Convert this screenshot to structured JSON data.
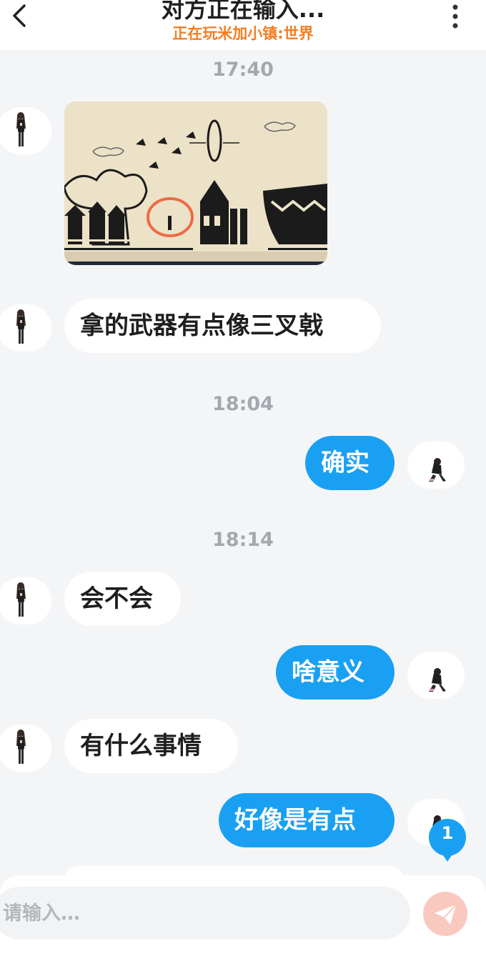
{
  "header": {
    "title": "对方正在输入...",
    "subtitle": "正在玩米加小镇:世界",
    "back_icon": "chevron-left-icon",
    "more_icon": "more-vertical-icon",
    "subtitle_color": "#f57c22"
  },
  "timestamps": [
    "17:40",
    "18:04",
    "18:14"
  ],
  "messages": [
    {
      "side": "in",
      "type": "image",
      "text": ""
    },
    {
      "side": "in",
      "type": "text",
      "text": "拿的武器有点像三叉戟"
    },
    {
      "side": "out",
      "type": "text",
      "text": "确实"
    },
    {
      "side": "in",
      "type": "text",
      "text": "会不会"
    },
    {
      "side": "out",
      "type": "text",
      "text": "啥意义"
    },
    {
      "side": "in",
      "type": "text",
      "text": "有什么事情"
    },
    {
      "side": "out",
      "type": "text",
      "text": "好像是有点"
    }
  ],
  "unread_badge": {
    "count": "1",
    "color": "#1aa0f2"
  },
  "composer": {
    "placeholder": "请输入…",
    "send_icon": "paper-plane-icon"
  },
  "colors": {
    "outgoing_bubble": "#1aa0f2",
    "incoming_bubble": "#ffffff",
    "background": "#f4f5f7",
    "send_button": "#f9c9c0"
  }
}
